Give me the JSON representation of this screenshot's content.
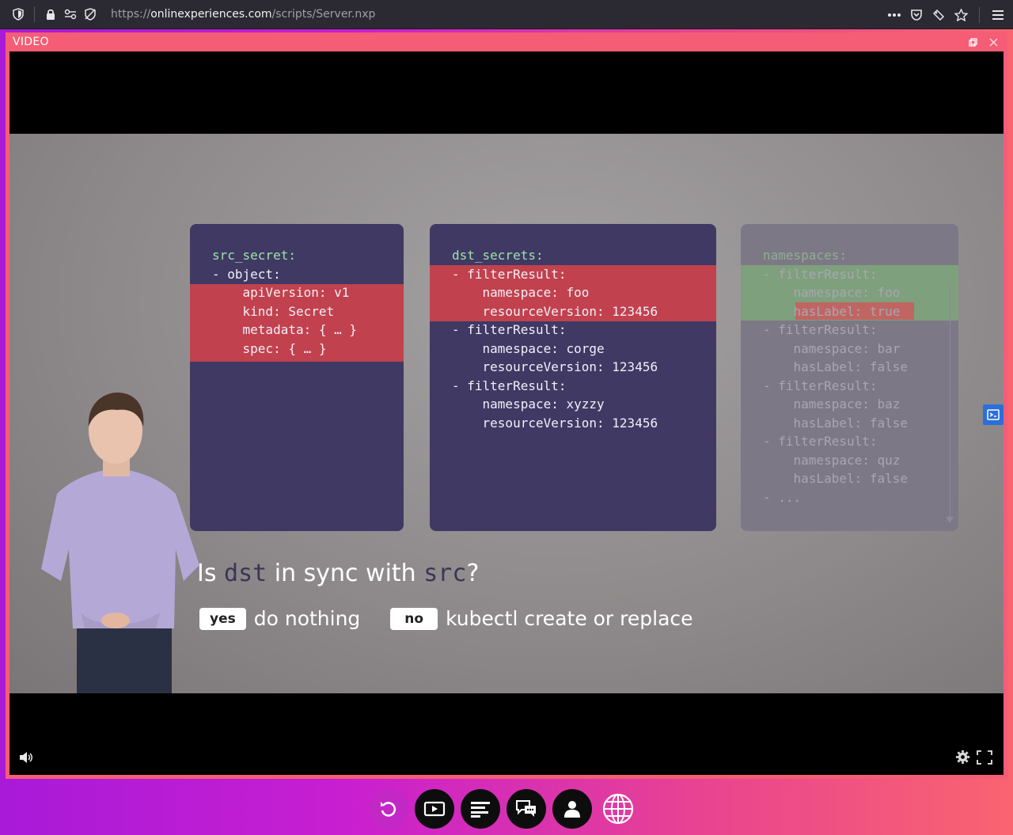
{
  "browser": {
    "url_scheme": "https://",
    "url_host": "onlinexperiences.com",
    "url_path": "/scripts/Server.nxp"
  },
  "video_window": {
    "title": "VIDEO"
  },
  "slide": {
    "panels": [
      {
        "lines": [
          "src_secret:",
          "- object:",
          "    apiVersion: v1",
          "    kind: Secret",
          "    metadata: { … }",
          "    spec: { … }"
        ]
      },
      {
        "lines": [
          "dst_secrets:",
          "- filterResult:",
          "    namespace: foo",
          "    resourceVersion: 123456",
          "- filterResult:",
          "    namespace: corge",
          "    resourceVersion: 123456",
          "- filterResult:",
          "    namespace: xyzzy",
          "    resourceVersion: 123456"
        ]
      },
      {
        "lines": [
          "namespaces:",
          "- filterResult:",
          "    namespace: foo",
          "    hasLabel: true",
          "- filterResult:",
          "    namespace: bar",
          "    hasLabel: false",
          "- filterResult:",
          "    namespace: baz",
          "    hasLabel: false",
          "- filterResult:",
          "    namespace: quz",
          "    hasLabel: false",
          "- ..."
        ]
      }
    ],
    "question": {
      "prefix": "Is ",
      "kw1": "dst",
      "middle": " in sync with ",
      "kw2": "src",
      "suffix": "?"
    },
    "answers": {
      "yes_label": "yes",
      "yes_text": "do nothing",
      "no_label": "no",
      "no_text": "kubectl create or replace"
    }
  },
  "colors": {
    "accent": "#f45d75",
    "panel": "#3f3964",
    "highlight_red": "#c2414e",
    "highlight_green": "#7ea07c"
  }
}
